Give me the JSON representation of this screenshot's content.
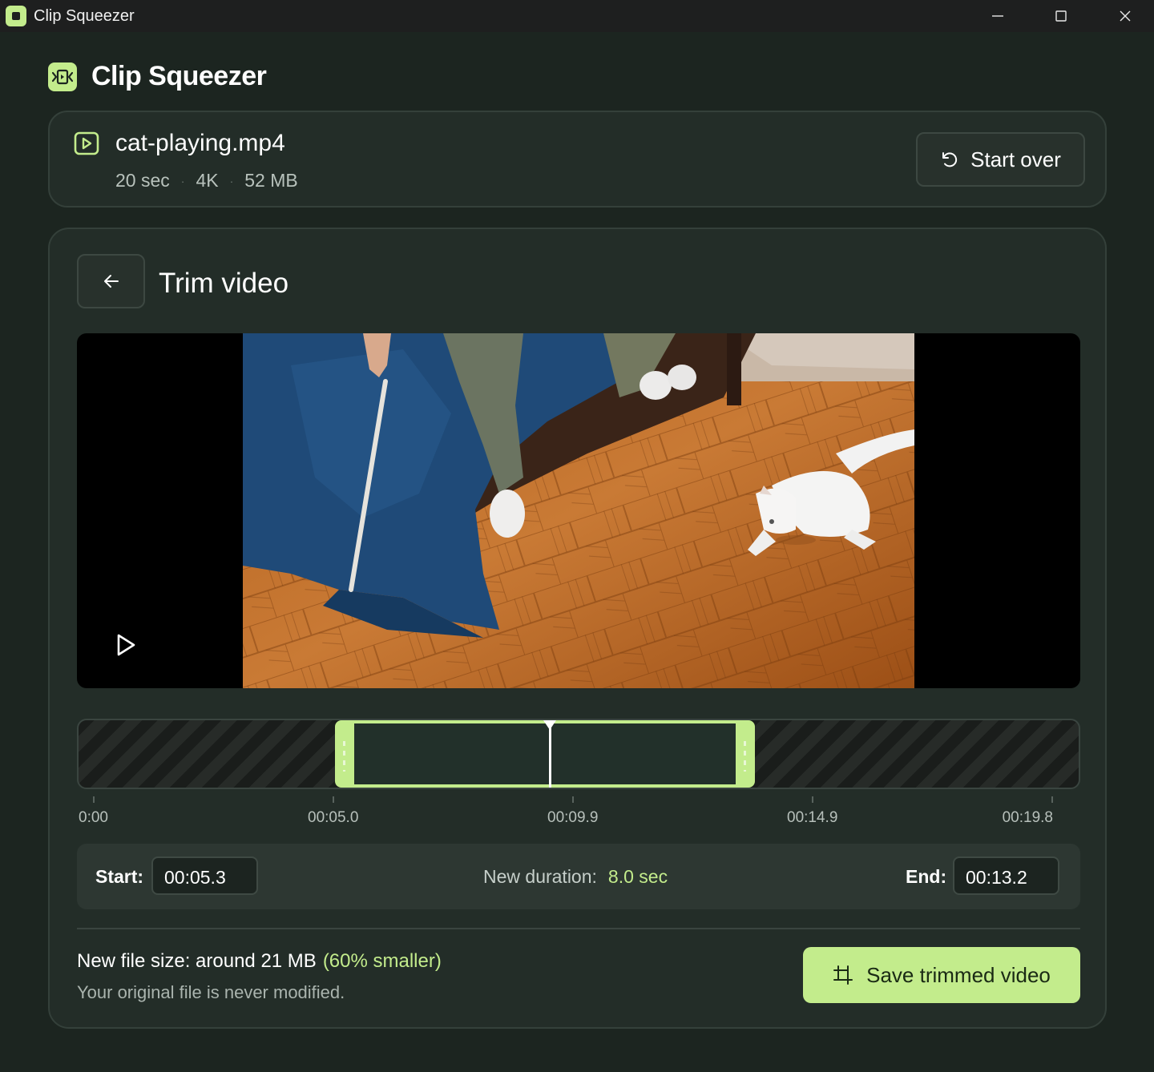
{
  "window": {
    "title": "Clip Squeezer"
  },
  "header": {
    "app_name": "Clip Squeezer"
  },
  "file": {
    "name": "cat-playing.mp4",
    "duration": "20 sec",
    "resolution": "4K",
    "size": "52 MB",
    "separator": "·"
  },
  "actions": {
    "start_over": "Start over"
  },
  "trim": {
    "title": "Trim video",
    "timeline": {
      "total_seconds": 19.8,
      "selection_start_fraction": 0.2565,
      "selection_end_fraction": 0.6765,
      "playhead_fraction": 0.4712,
      "ticks": [
        "0:00",
        "00:05.0",
        "00:09.9",
        "00:14.9",
        "00:19.8"
      ]
    },
    "start_label": "Start:",
    "start_value": "00:05.3",
    "duration_label": "New duration:",
    "duration_value": "8.0 sec",
    "end_label": "End:",
    "end_value": "00:13.2"
  },
  "summary": {
    "size_text": "New file size: around 21 MB",
    "size_pct": "(60% smaller)",
    "note": "Your original file is never modified.",
    "save_label": "Save trimmed video"
  },
  "colors": {
    "accent": "#c3ec8c",
    "background": "#1c2520",
    "card": "#232d28"
  }
}
